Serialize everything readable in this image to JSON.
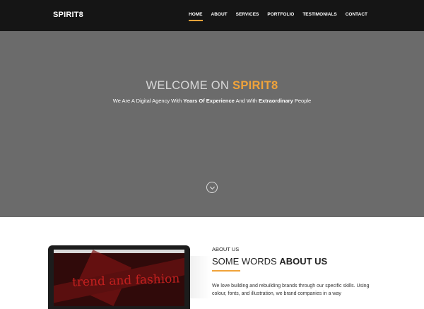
{
  "header": {
    "brand": "SPIRIT8",
    "nav": [
      "HOME",
      "ABOUT",
      "SERVICES",
      "PORTFOLIO",
      "TESTIMONIALS",
      "CONTACT"
    ],
    "active_index": 0
  },
  "hero": {
    "title_prefix": "WELCOME ON ",
    "title_accent": "SPIRIT8",
    "subtitle_1": "We Are A Digital Agency With ",
    "subtitle_bold_1": "Years Of Experience",
    "subtitle_2": " And With ",
    "subtitle_bold_2": "Extraordinary",
    "subtitle_3": " People",
    "scroll_icon": "chevron-down-icon"
  },
  "about": {
    "label": "ABOUT US",
    "title_prefix": "SOME WORDS ",
    "title_bold": "ABOUT US",
    "text": "We love building and rebuilding brands through our specific skills. Using colour, fonts, and illustration, we brand companies in a way",
    "laptop_screen_text": "trend and fashion"
  },
  "colors": {
    "accent": "#f0a33a",
    "navbar": "#151515",
    "hero": "#6b6b6b"
  }
}
